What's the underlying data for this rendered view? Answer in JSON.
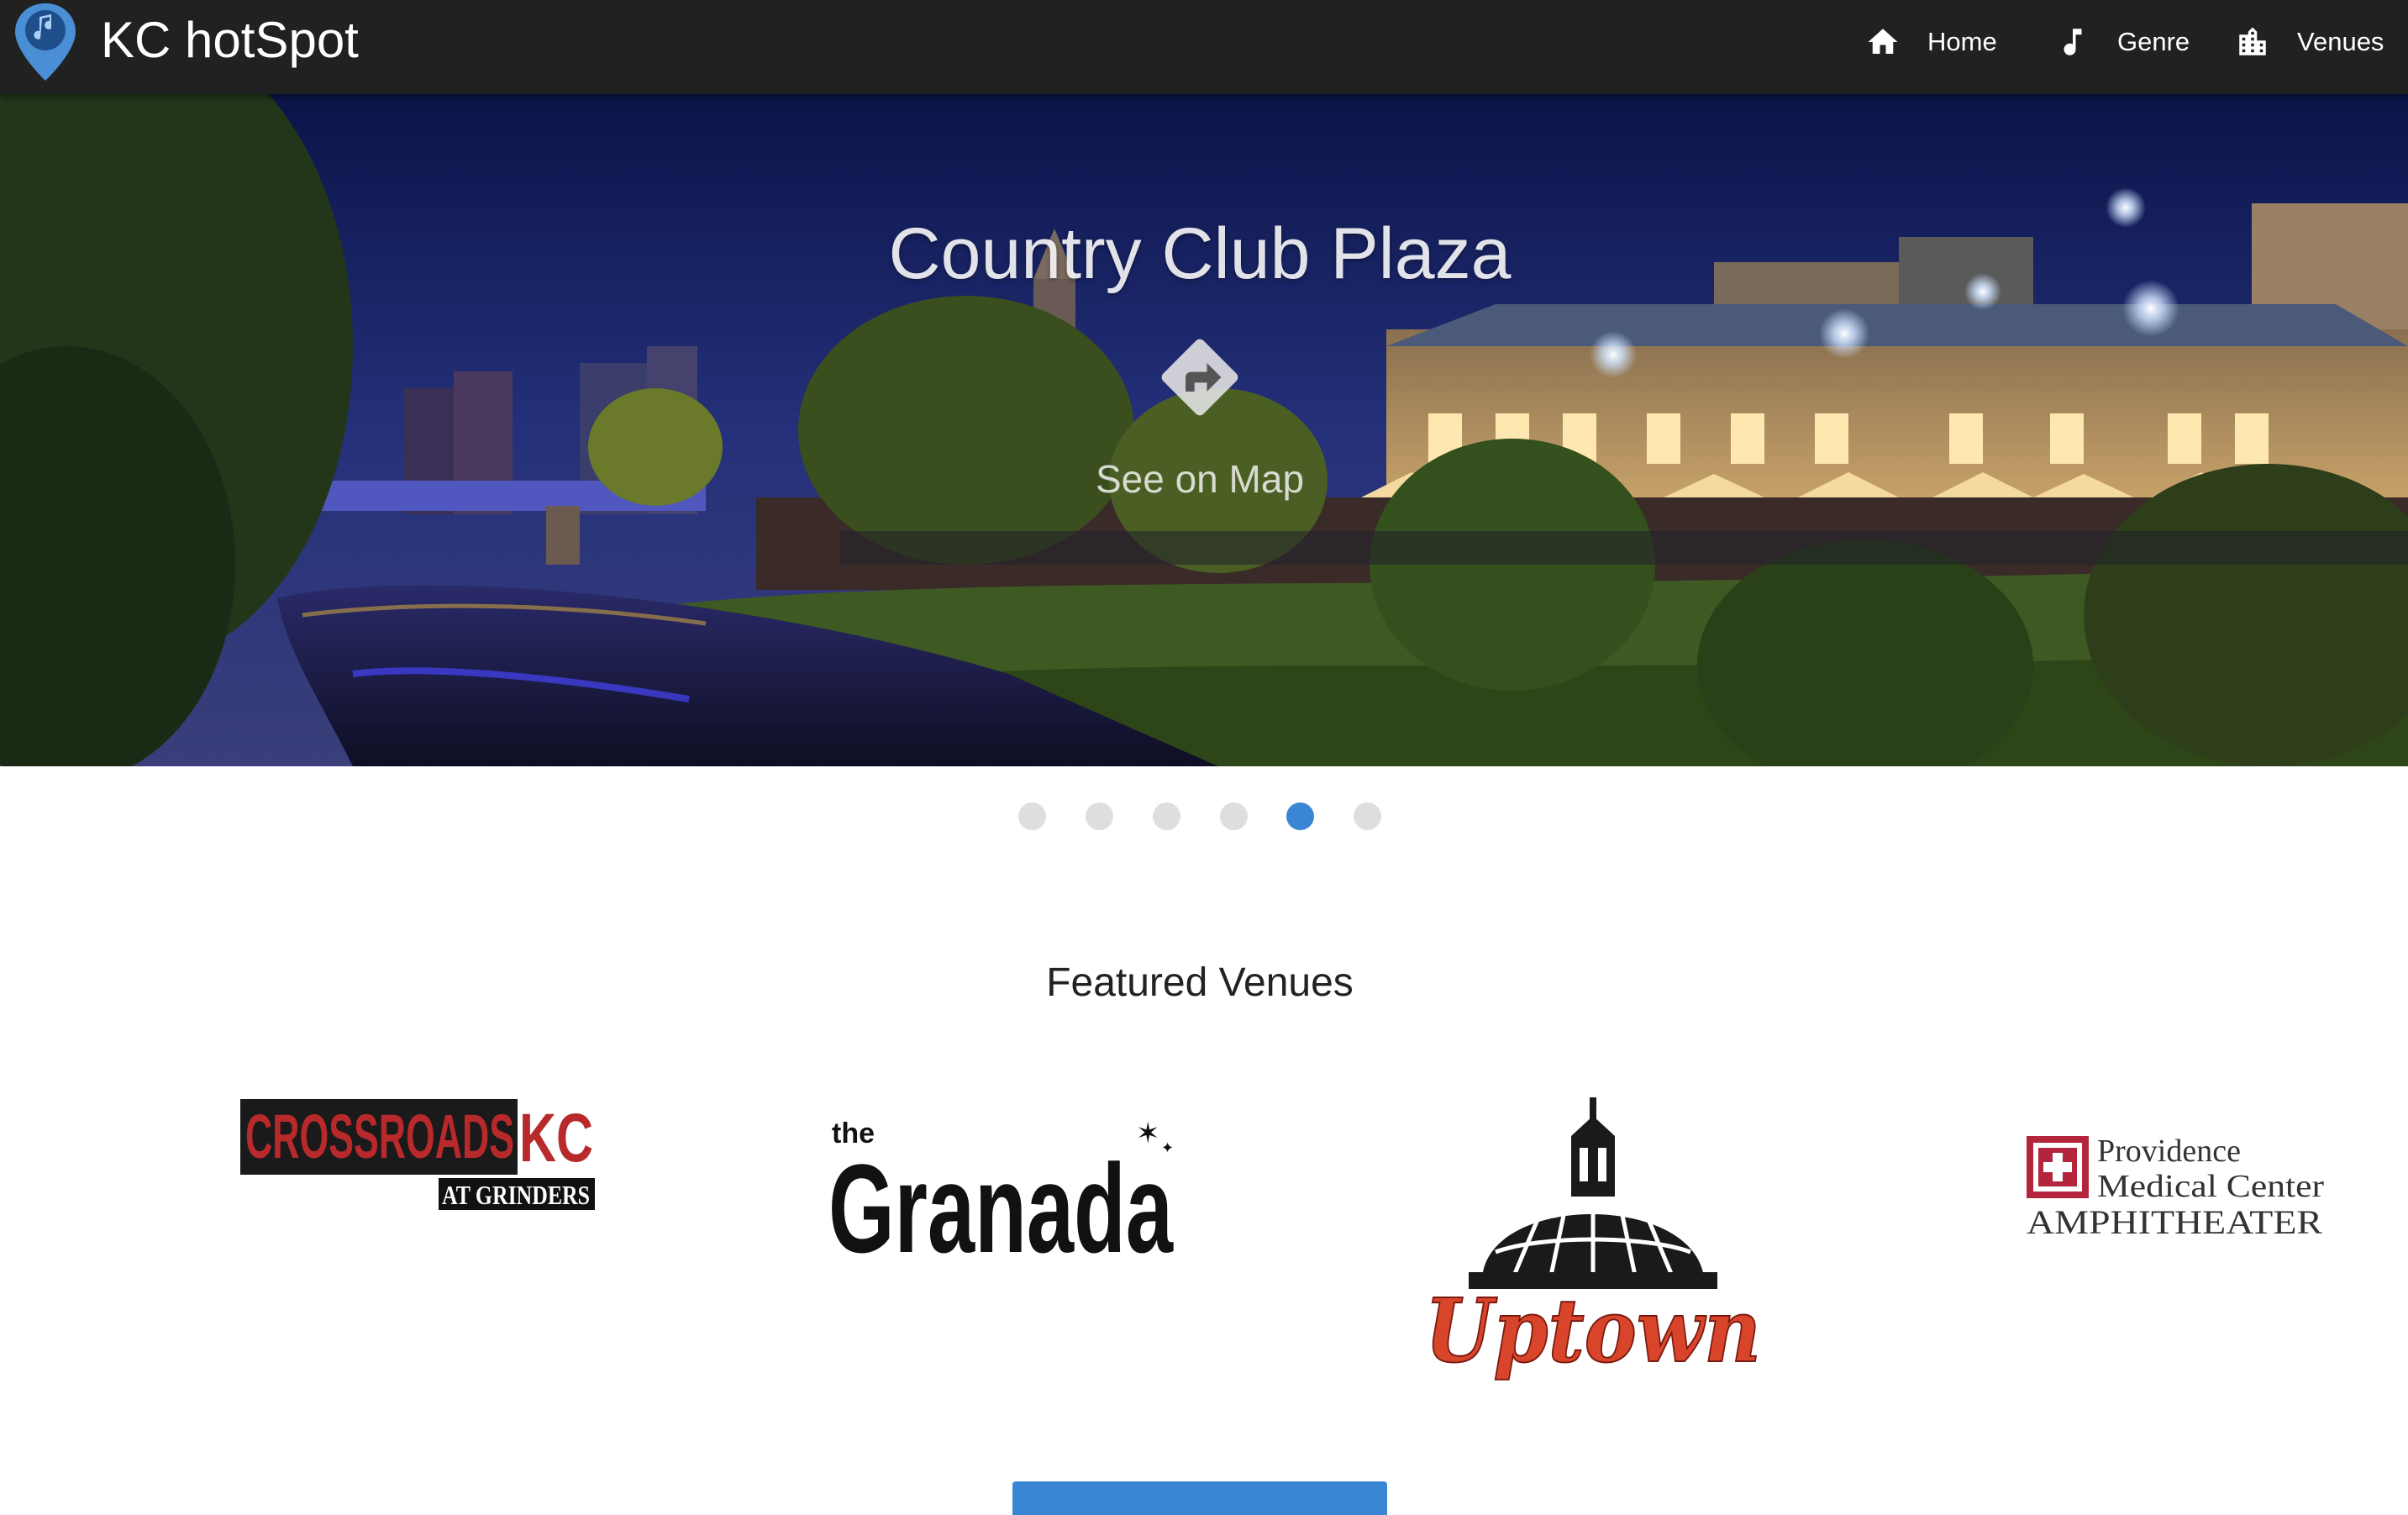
{
  "app": {
    "title": "KC hotSpot",
    "logo_icon": "music-map-pin-icon"
  },
  "nav": {
    "items": [
      {
        "label": "Home",
        "icon": "home-icon"
      },
      {
        "label": "Genre",
        "icon": "music-note-icon"
      },
      {
        "label": "Venues",
        "icon": "city-buildings-icon"
      }
    ]
  },
  "hero": {
    "title": "Country Club Plaza",
    "map_link_label": "See on Map",
    "map_icon": "directions-sign-icon"
  },
  "carousel": {
    "slide_count": 6,
    "active_index": 4
  },
  "featured": {
    "title": "Featured Venues",
    "venues": [
      {
        "name": "Crossroads KC at Grinders",
        "logo_text": [
          "CROSSROADS",
          "KC",
          "AT GRINDERS"
        ]
      },
      {
        "name": "The Granada",
        "logo_text": [
          "the",
          "Granada"
        ]
      },
      {
        "name": "Uptown",
        "logo_text": [
          "Uptown"
        ]
      },
      {
        "name": "Providence Medical Center Amphitheater",
        "logo_text": [
          "Providence",
          "Medical Center",
          "AMPHITHEATER"
        ]
      }
    ]
  },
  "colors": {
    "navbar_bg": "#212121",
    "accent": "#3a86d4",
    "dot_inactive": "#dedede",
    "crossroads_red": "#b8292b",
    "uptown_orange": "#d8452a",
    "providence_red": "#b3243d"
  }
}
